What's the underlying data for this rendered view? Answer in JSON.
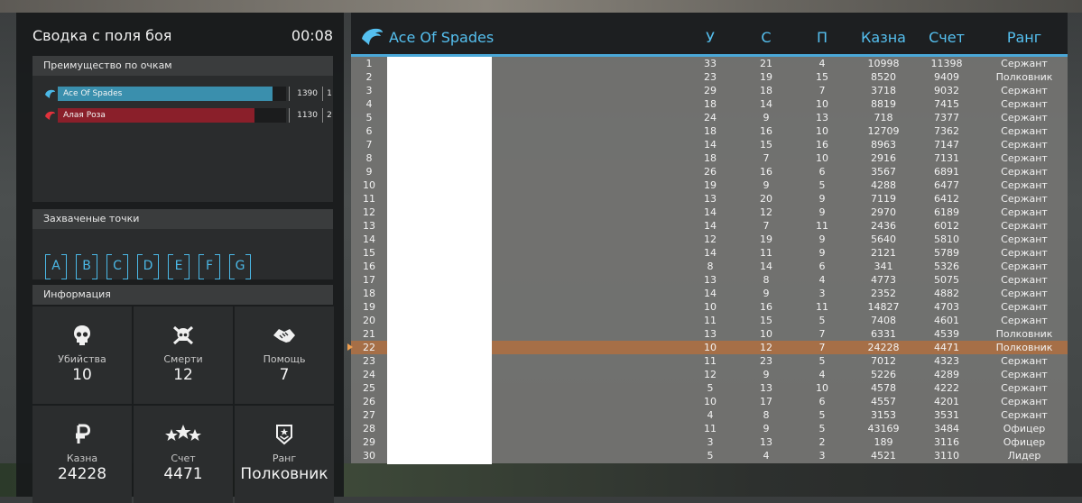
{
  "left": {
    "title": "Сводка с поля боя",
    "timer": "00:08",
    "score_section": "Преимущество по очкам",
    "teams": [
      {
        "name": "Ace Of Spades",
        "score": "1390",
        "rank": "1",
        "fill": 0.94,
        "color": "#3a8fad"
      },
      {
        "name": "Алая Роза",
        "score": "1130",
        "rank": "2",
        "fill": 0.86,
        "color": "#8a1f2a"
      }
    ],
    "points_section": "Захваченые точки",
    "points": [
      "A",
      "B",
      "C",
      "D",
      "E",
      "F",
      "G"
    ],
    "info_section": "Информация",
    "stats": [
      {
        "icon": "skull-icon",
        "label": "Убийства",
        "value": "10"
      },
      {
        "icon": "skull-crossbones-icon",
        "label": "Смерти",
        "value": "12"
      },
      {
        "icon": "handshake-icon",
        "label": "Помощь",
        "value": "7"
      },
      {
        "icon": "ruble-icon",
        "label": "Казна",
        "value": "24228"
      },
      {
        "icon": "stars-icon",
        "label": "Счет",
        "value": "4471"
      },
      {
        "icon": "rank-badge-icon",
        "label": "Ранг",
        "value": "Полковник"
      }
    ]
  },
  "board": {
    "team_title": "Ace Of Spades",
    "accent": "#55c0f0",
    "highlight_color": "#a66f47",
    "columns": [
      "У",
      "С",
      "П",
      "Казна",
      "Счет",
      "Ранг"
    ],
    "rows": [
      [
        "1",
        "33",
        "21",
        "4",
        "10998",
        "11398",
        "Сержант"
      ],
      [
        "2",
        "23",
        "19",
        "15",
        "8520",
        "9409",
        "Полковник"
      ],
      [
        "3",
        "29",
        "18",
        "7",
        "3718",
        "9032",
        "Сержант"
      ],
      [
        "4",
        "18",
        "14",
        "10",
        "8819",
        "7415",
        "Сержант"
      ],
      [
        "5",
        "24",
        "9",
        "13",
        "718",
        "7377",
        "Сержант"
      ],
      [
        "6",
        "18",
        "16",
        "10",
        "12709",
        "7362",
        "Сержант"
      ],
      [
        "7",
        "14",
        "15",
        "16",
        "8963",
        "7147",
        "Сержант"
      ],
      [
        "8",
        "18",
        "7",
        "10",
        "2916",
        "7131",
        "Сержант"
      ],
      [
        "9",
        "26",
        "16",
        "6",
        "3567",
        "6891",
        "Сержант"
      ],
      [
        "10",
        "19",
        "9",
        "5",
        "4288",
        "6477",
        "Сержант"
      ],
      [
        "11",
        "13",
        "20",
        "9",
        "7119",
        "6412",
        "Сержант"
      ],
      [
        "12",
        "14",
        "12",
        "9",
        "2970",
        "6189",
        "Сержант"
      ],
      [
        "13",
        "14",
        "7",
        "11",
        "2436",
        "6012",
        "Сержант"
      ],
      [
        "14",
        "12",
        "19",
        "9",
        "5640",
        "5810",
        "Сержант"
      ],
      [
        "15",
        "14",
        "11",
        "9",
        "2121",
        "5789",
        "Сержант"
      ],
      [
        "16",
        "8",
        "14",
        "6",
        "341",
        "5326",
        "Сержант"
      ],
      [
        "17",
        "13",
        "8",
        "4",
        "4773",
        "5075",
        "Сержант"
      ],
      [
        "18",
        "14",
        "9",
        "3",
        "2352",
        "4882",
        "Сержант"
      ],
      [
        "19",
        "10",
        "16",
        "11",
        "14827",
        "4703",
        "Сержант"
      ],
      [
        "20",
        "11",
        "15",
        "5",
        "7408",
        "4601",
        "Сержант"
      ],
      [
        "21",
        "13",
        "10",
        "7",
        "6331",
        "4539",
        "Полковник"
      ],
      [
        "22",
        "10",
        "12",
        "7",
        "24228",
        "4471",
        "Полковник"
      ],
      [
        "23",
        "11",
        "23",
        "5",
        "7012",
        "4323",
        "Сержант"
      ],
      [
        "24",
        "12",
        "9",
        "4",
        "5226",
        "4289",
        "Сержант"
      ],
      [
        "25",
        "5",
        "13",
        "10",
        "4578",
        "4222",
        "Сержант"
      ],
      [
        "26",
        "10",
        "17",
        "6",
        "4557",
        "4201",
        "Сержант"
      ],
      [
        "27",
        "4",
        "8",
        "5",
        "3153",
        "3531",
        "Сержант"
      ],
      [
        "28",
        "11",
        "9",
        "5",
        "43169",
        "3484",
        "Офицер"
      ],
      [
        "29",
        "3",
        "13",
        "2",
        "189",
        "3116",
        "Офицер"
      ],
      [
        "30",
        "5",
        "4",
        "3",
        "4521",
        "3110",
        "Лидер"
      ]
    ],
    "current_player_row": 21
  }
}
